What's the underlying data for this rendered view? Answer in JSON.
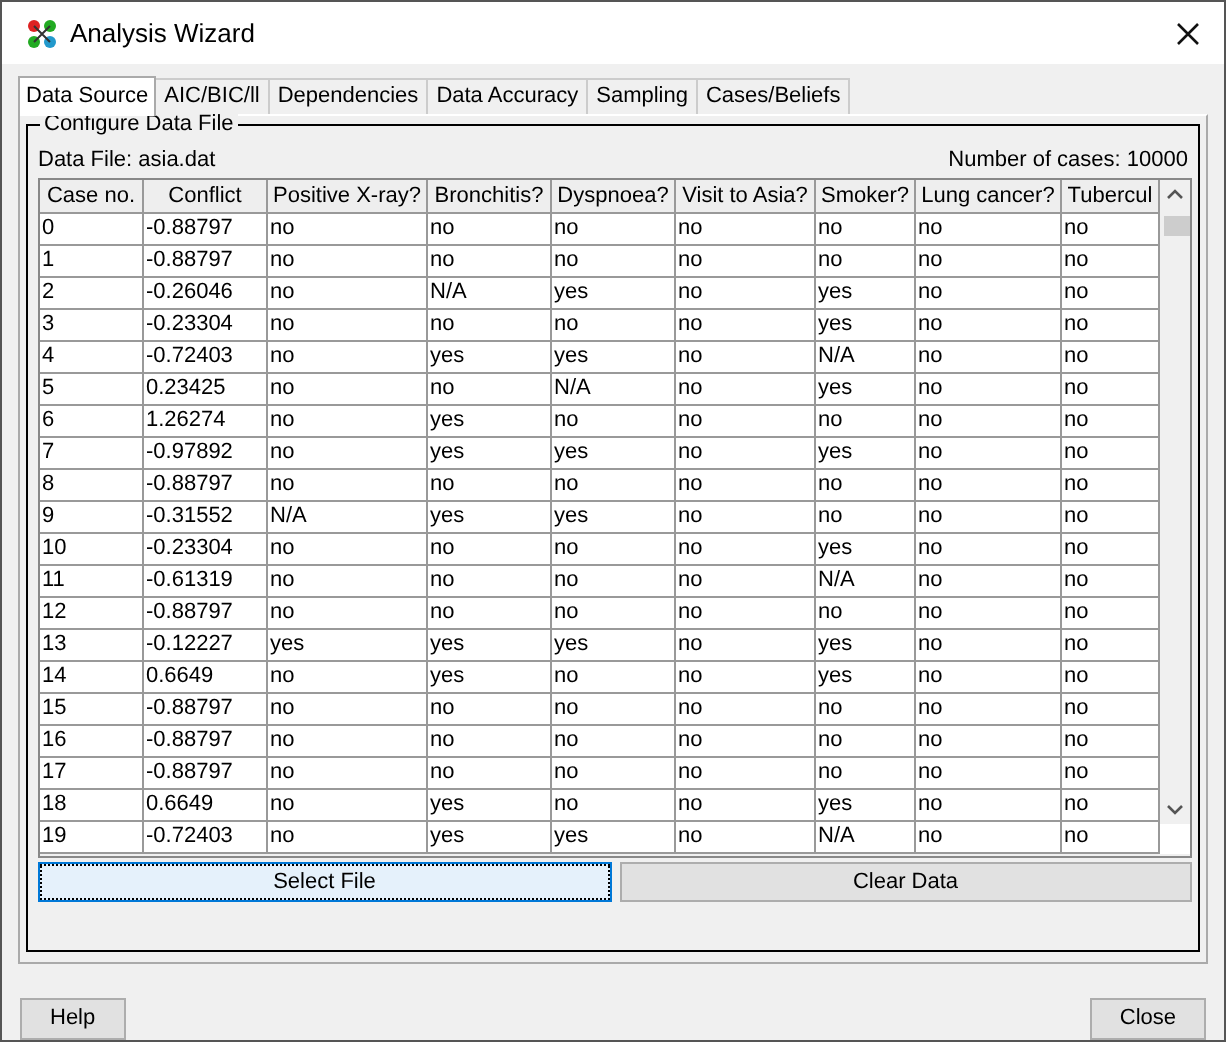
{
  "window": {
    "title": "Analysis Wizard"
  },
  "tabs": [
    {
      "label": "Data Source",
      "selected": true
    },
    {
      "label": "AIC/BIC/ll",
      "selected": false
    },
    {
      "label": "Dependencies",
      "selected": false
    },
    {
      "label": "Data Accuracy",
      "selected": false
    },
    {
      "label": "Sampling",
      "selected": false
    },
    {
      "label": "Cases/Beliefs",
      "selected": false
    }
  ],
  "group_title": "Configure Data File",
  "data_file": "Data File: asia.dat",
  "case_count": "Number of cases: 10000",
  "table": {
    "columns": [
      "Case no.",
      "Conflict",
      "Positive X-ray?",
      "Bronchitis?",
      "Dyspnoea?",
      "Visit to Asia?",
      "Smoker?",
      "Lung cancer?",
      "Tubercul"
    ],
    "rows": [
      [
        "0",
        "-0.88797",
        "no",
        "no",
        "no",
        "no",
        "no",
        "no",
        "no"
      ],
      [
        "1",
        "-0.88797",
        "no",
        "no",
        "no",
        "no",
        "no",
        "no",
        "no"
      ],
      [
        "2",
        "-0.26046",
        "no",
        "N/A",
        "yes",
        "no",
        "yes",
        "no",
        "no"
      ],
      [
        "3",
        "-0.23304",
        "no",
        "no",
        "no",
        "no",
        "yes",
        "no",
        "no"
      ],
      [
        "4",
        "-0.72403",
        "no",
        "yes",
        "yes",
        "no",
        "N/A",
        "no",
        "no"
      ],
      [
        "5",
        "0.23425",
        "no",
        "no",
        "N/A",
        "no",
        "yes",
        "no",
        "no"
      ],
      [
        "6",
        "1.26274",
        "no",
        "yes",
        "no",
        "no",
        "no",
        "no",
        "no"
      ],
      [
        "7",
        "-0.97892",
        "no",
        "yes",
        "yes",
        "no",
        "yes",
        "no",
        "no"
      ],
      [
        "8",
        "-0.88797",
        "no",
        "no",
        "no",
        "no",
        "no",
        "no",
        "no"
      ],
      [
        "9",
        "-0.31552",
        "N/A",
        "yes",
        "yes",
        "no",
        "no",
        "no",
        "no"
      ],
      [
        "10",
        "-0.23304",
        "no",
        "no",
        "no",
        "no",
        "yes",
        "no",
        "no"
      ],
      [
        "11",
        "-0.61319",
        "no",
        "no",
        "no",
        "no",
        "N/A",
        "no",
        "no"
      ],
      [
        "12",
        "-0.88797",
        "no",
        "no",
        "no",
        "no",
        "no",
        "no",
        "no"
      ],
      [
        "13",
        "-0.12227",
        "yes",
        "yes",
        "yes",
        "no",
        "yes",
        "no",
        "no"
      ],
      [
        "14",
        "0.6649",
        "no",
        "yes",
        "no",
        "no",
        "yes",
        "no",
        "no"
      ],
      [
        "15",
        "-0.88797",
        "no",
        "no",
        "no",
        "no",
        "no",
        "no",
        "no"
      ],
      [
        "16",
        "-0.88797",
        "no",
        "no",
        "no",
        "no",
        "no",
        "no",
        "no"
      ],
      [
        "17",
        "-0.88797",
        "no",
        "no",
        "no",
        "no",
        "no",
        "no",
        "no"
      ],
      [
        "18",
        "0.6649",
        "no",
        "yes",
        "no",
        "no",
        "yes",
        "no",
        "no"
      ],
      [
        "19",
        "-0.72403",
        "no",
        "yes",
        "yes",
        "no",
        "N/A",
        "no",
        "no"
      ]
    ]
  },
  "actions": [
    {
      "label": "Select File",
      "selected": true
    },
    {
      "label": "Clear Data",
      "selected": false
    }
  ],
  "footer_buttons": [
    "Help",
    "Close"
  ]
}
